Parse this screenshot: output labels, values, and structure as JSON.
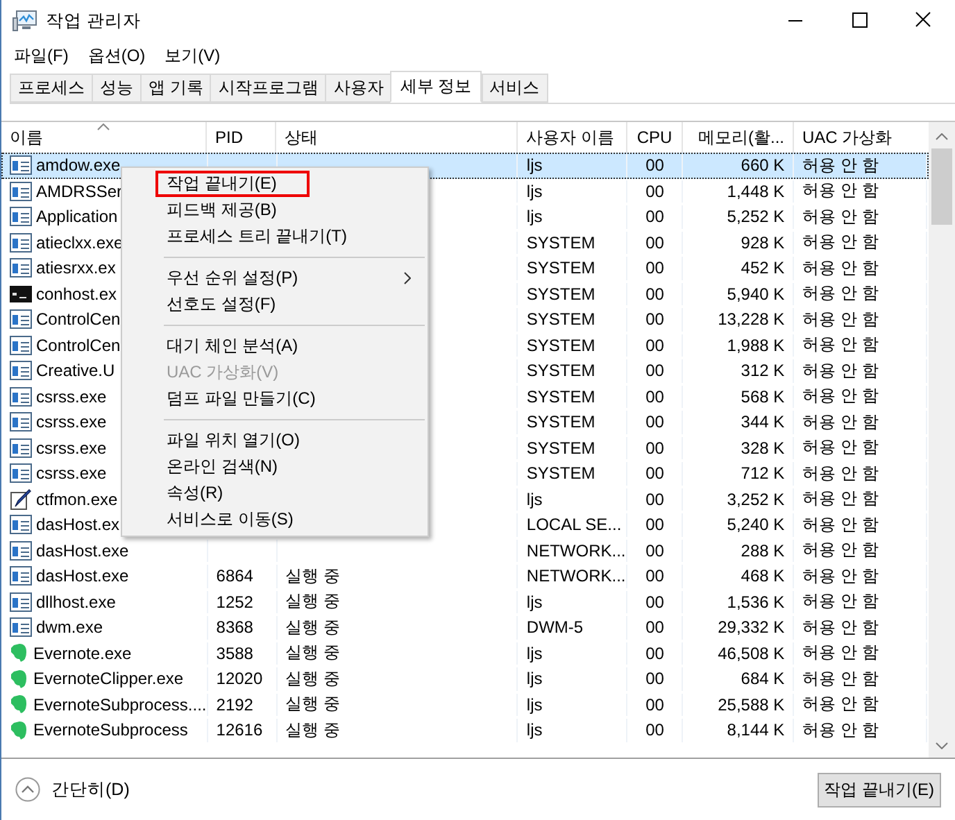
{
  "window": {
    "title": "작업 관리자"
  },
  "menu_bar": [
    "파일(F)",
    "옵션(O)",
    "보기(V)"
  ],
  "tabs": [
    {
      "label": "프로세스",
      "selected": false
    },
    {
      "label": "성능",
      "selected": false
    },
    {
      "label": "앱 기록",
      "selected": false
    },
    {
      "label": "시작프로그램",
      "selected": false
    },
    {
      "label": "사용자",
      "selected": false
    },
    {
      "label": "세부 정보",
      "selected": true
    },
    {
      "label": "서비스",
      "selected": false
    }
  ],
  "table": {
    "columns": [
      "이름",
      "PID",
      "상태",
      "사용자 이름",
      "CPU",
      "메모리(활...",
      "UAC 가상화"
    ],
    "rows": [
      {
        "kind": "window",
        "name": "amdow.exe",
        "user": "ljs",
        "cpu": "00",
        "memory": "660 K",
        "uac": "허용 안 함",
        "selected": true
      },
      {
        "kind": "window",
        "name": "AMDRSSer",
        "user": "ljs",
        "cpu": "00",
        "memory": "1,448 K",
        "uac": "허용 안 함",
        "selected": false
      },
      {
        "kind": "window",
        "name": "Application",
        "user": "ljs",
        "cpu": "00",
        "memory": "5,252 K",
        "uac": "허용 안 함",
        "selected": false
      },
      {
        "kind": "window",
        "name": "atieclxx.exe",
        "user": "SYSTEM",
        "cpu": "00",
        "memory": "928 K",
        "uac": "허용 안 함",
        "selected": false
      },
      {
        "kind": "window",
        "name": "atiesrxx.ex",
        "user": "SYSTEM",
        "cpu": "00",
        "memory": "452 K",
        "uac": "허용 안 함",
        "selected": false
      },
      {
        "kind": "console",
        "name": "conhost.ex",
        "user": "SYSTEM",
        "cpu": "00",
        "memory": "5,940 K",
        "uac": "허용 안 함",
        "selected": false
      },
      {
        "kind": "window",
        "name": "ControlCen",
        "user": "SYSTEM",
        "cpu": "00",
        "memory": "13,228 K",
        "uac": "허용 안 함",
        "selected": false
      },
      {
        "kind": "window",
        "name": "ControlCen",
        "user": "SYSTEM",
        "cpu": "00",
        "memory": "1,988 K",
        "uac": "허용 안 함",
        "selected": false
      },
      {
        "kind": "window",
        "name": "Creative.U",
        "user": "SYSTEM",
        "cpu": "00",
        "memory": "312 K",
        "uac": "허용 안 함",
        "selected": false
      },
      {
        "kind": "window",
        "name": "csrss.exe",
        "user": "SYSTEM",
        "cpu": "00",
        "memory": "568 K",
        "uac": "허용 안 함",
        "selected": false
      },
      {
        "kind": "window",
        "name": "csrss.exe",
        "user": "SYSTEM",
        "cpu": "00",
        "memory": "344 K",
        "uac": "허용 안 함",
        "selected": false
      },
      {
        "kind": "window",
        "name": "csrss.exe",
        "user": "SYSTEM",
        "cpu": "00",
        "memory": "328 K",
        "uac": "허용 안 함",
        "selected": false
      },
      {
        "kind": "window",
        "name": "csrss.exe",
        "user": "SYSTEM",
        "cpu": "00",
        "memory": "712 K",
        "uac": "허용 안 함",
        "selected": false
      },
      {
        "kind": "pen",
        "name": "ctfmon.exe",
        "user": "ljs",
        "cpu": "00",
        "memory": "3,252 K",
        "uac": "허용 안 함",
        "selected": false
      },
      {
        "kind": "window",
        "name": "dasHost.ex",
        "user": "LOCAL SE...",
        "cpu": "00",
        "memory": "5,240 K",
        "uac": "허용 안 함",
        "selected": false
      },
      {
        "kind": "window",
        "name": "dasHost.exe",
        "user": "NETWORK...",
        "cpu": "00",
        "memory": "288 K",
        "uac": "허용 안 함",
        "selected": false
      },
      {
        "kind": "window",
        "name": "dasHost.exe",
        "pid": "6864",
        "status": "실행 중",
        "user": "NETWORK...",
        "cpu": "00",
        "memory": "468 K",
        "uac": "허용 안 함",
        "selected": false
      },
      {
        "kind": "window",
        "name": "dllhost.exe",
        "pid": "1252",
        "status": "실행 중",
        "user": "ljs",
        "cpu": "00",
        "memory": "1,536 K",
        "uac": "허용 안 함",
        "selected": false
      },
      {
        "kind": "window",
        "name": "dwm.exe",
        "pid": "8368",
        "status": "실행 중",
        "user": "DWM-5",
        "cpu": "00",
        "memory": "29,332 K",
        "uac": "허용 안 함",
        "selected": false
      },
      {
        "kind": "leaf",
        "name": "Evernote.exe",
        "pid": "3588",
        "status": "실행 중",
        "user": "ljs",
        "cpu": "00",
        "memory": "46,508 K",
        "uac": "허용 안 함",
        "selected": false
      },
      {
        "kind": "leaf",
        "name": "EvernoteClipper.exe",
        "pid": "12020",
        "status": "실행 중",
        "user": "ljs",
        "cpu": "00",
        "memory": "684 K",
        "uac": "허용 안 함",
        "selected": false
      },
      {
        "kind": "leaf",
        "name": "EvernoteSubprocess....",
        "pid": "2192",
        "status": "실행 중",
        "user": "ljs",
        "cpu": "00",
        "memory": "25,588 K",
        "uac": "허용 안 함",
        "selected": false
      },
      {
        "kind": "leaf",
        "name": "EvernoteSubprocess",
        "pid": "12616",
        "status": "실행 중",
        "user": "ljs",
        "cpu": "00",
        "memory": "8,144 K",
        "uac": "허용 안 함",
        "selected": false
      }
    ]
  },
  "context_menu": [
    [
      {
        "label": "작업 끝내기(E)",
        "disabled": false,
        "boxed": true,
        "submenu": false
      },
      {
        "label": "피드백 제공(B)",
        "disabled": false,
        "boxed": false,
        "submenu": false
      },
      {
        "label": "프로세스 트리 끝내기(T)",
        "disabled": false,
        "boxed": false,
        "submenu": false
      }
    ],
    [
      {
        "label": "우선 순위 설정(P)",
        "disabled": false,
        "boxed": false,
        "submenu": true
      },
      {
        "label": "선호도 설정(F)",
        "disabled": false,
        "boxed": false,
        "submenu": false
      }
    ],
    [
      {
        "label": "대기 체인 분석(A)",
        "disabled": false,
        "boxed": false,
        "submenu": false
      },
      {
        "label": "UAC 가상화(V)",
        "disabled": true,
        "boxed": false,
        "submenu": false
      },
      {
        "label": "덤프 파일 만들기(C)",
        "disabled": false,
        "boxed": false,
        "submenu": false
      }
    ],
    [
      {
        "label": "파일 위치 열기(O)",
        "disabled": false,
        "boxed": false,
        "submenu": false
      },
      {
        "label": "온라인 검색(N)",
        "disabled": false,
        "boxed": false,
        "submenu": false
      },
      {
        "label": "속성(R)",
        "disabled": false,
        "boxed": false,
        "submenu": false
      },
      {
        "label": "서비스로 이동(S)",
        "disabled": false,
        "boxed": false,
        "submenu": false
      }
    ]
  ],
  "footer": {
    "toggle": "간단히(D)",
    "button": "작업 끝내기(E)"
  }
}
